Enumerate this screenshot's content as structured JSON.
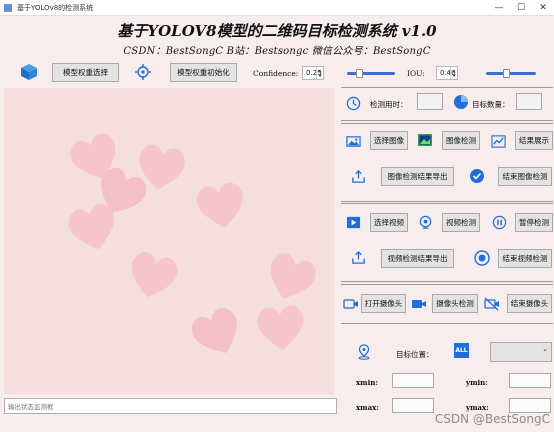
{
  "window": {
    "title": "基于YOLOv8的检测系统"
  },
  "header": {
    "title": "基于YOLOV8模型的二维码目标检测系统 v1.0",
    "subtitle": "CSDN：BestSongC   B站：Bestsongc   微信公众号：BestSongC"
  },
  "toolbar": {
    "select_model": "模型权重选择",
    "init_model": "模型权重初始化",
    "confidence_label": "Confidence:",
    "confidence_value": "0.25",
    "confidence_level": 0.25,
    "iou_label": "IOU:",
    "iou_value": "0.40",
    "iou_level": 0.4
  },
  "stats": {
    "time_label": "检测用时：",
    "count_label": "目标数量："
  },
  "image_panel": {
    "select_image": "选择图像",
    "detect_image": "图像检测",
    "show_result": "结果展示",
    "export_result": "图像检测结果导出",
    "end_detect": "结束图像检测"
  },
  "video_panel": {
    "select_video": "选择视频",
    "detect_video": "视频检测",
    "pause_detect": "暂停检测",
    "export_result": "视频检测结果导出",
    "end_detect": "结束视频检测"
  },
  "camera_panel": {
    "open_camera": "打开摄像头",
    "detect_camera": "摄像头检测",
    "close_camera": "结束摄像头"
  },
  "location_panel": {
    "position_label": "目标位置：",
    "all_badge": "ALL",
    "xmin": "xmin:",
    "ymin": "ymin:",
    "xmax": "xmax:",
    "ymax": "ymax:"
  },
  "log": {
    "placeholder": "输出状态监测框"
  },
  "watermark": "CSDN @BestSongC",
  "colors": {
    "accent": "#1e6fd9",
    "slider": "#3b6fd9",
    "heart": "#f6c6cc"
  }
}
